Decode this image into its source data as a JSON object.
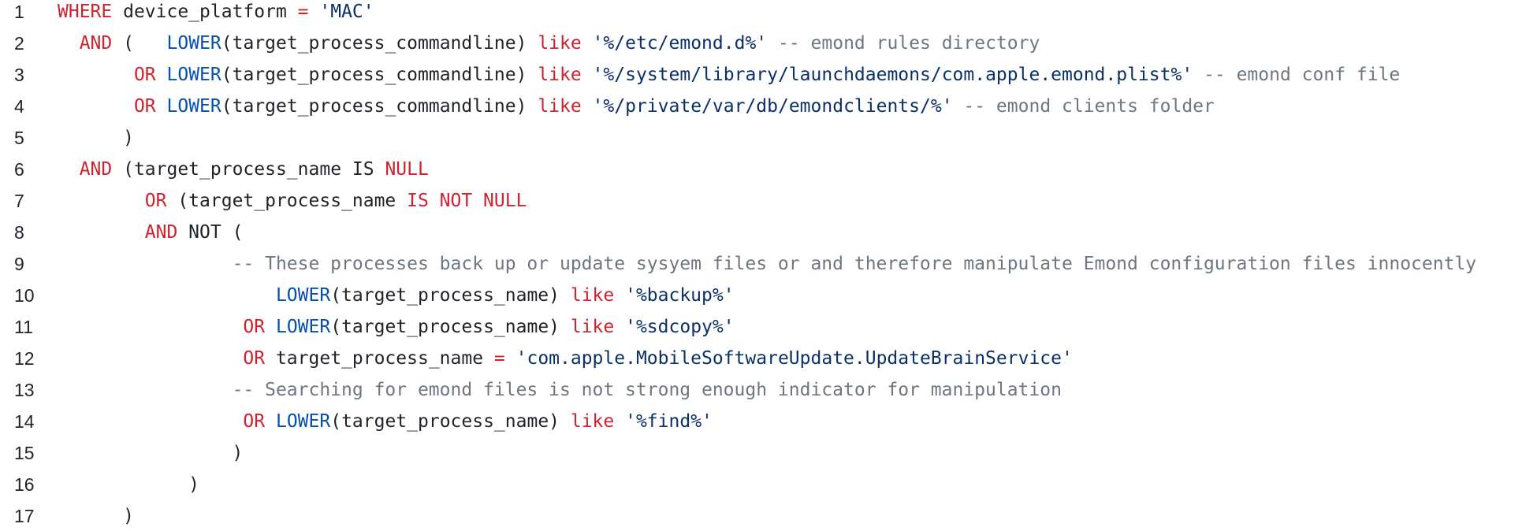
{
  "editor": {
    "lines": [
      {
        "n": "1",
        "tokens": [
          {
            "t": "WHERE",
            "c": "kw"
          },
          {
            "t": " device_platform ",
            "c": "pl"
          },
          {
            "t": "=",
            "c": "kw"
          },
          {
            "t": " ",
            "c": "pl"
          },
          {
            "t": "'MAC'",
            "c": "str"
          }
        ]
      },
      {
        "n": "2",
        "tokens": [
          {
            "t": "  ",
            "c": "pl"
          },
          {
            "t": "AND",
            "c": "kw"
          },
          {
            "t": " (   ",
            "c": "pl"
          },
          {
            "t": "LOWER",
            "c": "fn"
          },
          {
            "t": "(target_process_commandline) ",
            "c": "pl"
          },
          {
            "t": "like",
            "c": "kw"
          },
          {
            "t": " ",
            "c": "pl"
          },
          {
            "t": "'%/etc/emond.d%'",
            "c": "str"
          },
          {
            "t": " -- emond rules directory",
            "c": "cm"
          }
        ]
      },
      {
        "n": "3",
        "tokens": [
          {
            "t": "       ",
            "c": "pl"
          },
          {
            "t": "OR",
            "c": "kw"
          },
          {
            "t": " ",
            "c": "pl"
          },
          {
            "t": "LOWER",
            "c": "fn"
          },
          {
            "t": "(target_process_commandline) ",
            "c": "pl"
          },
          {
            "t": "like",
            "c": "kw"
          },
          {
            "t": " ",
            "c": "pl"
          },
          {
            "t": "'%/system/library/launchdaemons/com.apple.emond.plist%'",
            "c": "str"
          },
          {
            "t": " -- emond conf file",
            "c": "cm"
          }
        ]
      },
      {
        "n": "4",
        "tokens": [
          {
            "t": "       ",
            "c": "pl"
          },
          {
            "t": "OR",
            "c": "kw"
          },
          {
            "t": " ",
            "c": "pl"
          },
          {
            "t": "LOWER",
            "c": "fn"
          },
          {
            "t": "(target_process_commandline) ",
            "c": "pl"
          },
          {
            "t": "like",
            "c": "kw"
          },
          {
            "t": " ",
            "c": "pl"
          },
          {
            "t": "'%/private/var/db/emondclients/%'",
            "c": "str"
          },
          {
            "t": " -- emond clients folder",
            "c": "cm"
          }
        ]
      },
      {
        "n": "5",
        "tokens": [
          {
            "t": "      )",
            "c": "pl"
          }
        ]
      },
      {
        "n": "6",
        "tokens": [
          {
            "t": "  ",
            "c": "pl"
          },
          {
            "t": "AND",
            "c": "kw"
          },
          {
            "t": " (target_process_name IS ",
            "c": "pl"
          },
          {
            "t": "NULL",
            "c": "kw"
          }
        ]
      },
      {
        "n": "7",
        "tokens": [
          {
            "t": "        ",
            "c": "pl"
          },
          {
            "t": "OR",
            "c": "kw"
          },
          {
            "t": " (target_process_name ",
            "c": "pl"
          },
          {
            "t": "IS NOT NULL",
            "c": "kw"
          }
        ]
      },
      {
        "n": "8",
        "tokens": [
          {
            "t": "        ",
            "c": "pl"
          },
          {
            "t": "AND",
            "c": "kw"
          },
          {
            "t": " NOT (",
            "c": "pl"
          }
        ]
      },
      {
        "n": "9",
        "tokens": [
          {
            "t": "                ",
            "c": "pl"
          },
          {
            "t": "-- These processes back up or update sysyem files or and therefore manipulate Emond configuration files innocently",
            "c": "cm"
          }
        ]
      },
      {
        "n": "10",
        "tokens": [
          {
            "t": "                    ",
            "c": "pl"
          },
          {
            "t": "LOWER",
            "c": "fn"
          },
          {
            "t": "(target_process_name) ",
            "c": "pl"
          },
          {
            "t": "like",
            "c": "kw"
          },
          {
            "t": " ",
            "c": "pl"
          },
          {
            "t": "'%backup%'",
            "c": "str"
          }
        ]
      },
      {
        "n": "11",
        "tokens": [
          {
            "t": "                 ",
            "c": "pl"
          },
          {
            "t": "OR",
            "c": "kw"
          },
          {
            "t": " ",
            "c": "pl"
          },
          {
            "t": "LOWER",
            "c": "fn"
          },
          {
            "t": "(target_process_name) ",
            "c": "pl"
          },
          {
            "t": "like",
            "c": "kw"
          },
          {
            "t": " ",
            "c": "pl"
          },
          {
            "t": "'%sdcopy%'",
            "c": "str"
          }
        ]
      },
      {
        "n": "12",
        "tokens": [
          {
            "t": "                 ",
            "c": "pl"
          },
          {
            "t": "OR",
            "c": "kw"
          },
          {
            "t": " target_process_name ",
            "c": "pl"
          },
          {
            "t": "=",
            "c": "kw"
          },
          {
            "t": " ",
            "c": "pl"
          },
          {
            "t": "'com.apple.MobileSoftwareUpdate.UpdateBrainService'",
            "c": "str"
          }
        ]
      },
      {
        "n": "13",
        "tokens": [
          {
            "t": "                ",
            "c": "pl"
          },
          {
            "t": "-- Searching for emond files is not strong enough indicator for manipulation",
            "c": "cm"
          }
        ]
      },
      {
        "n": "14",
        "tokens": [
          {
            "t": "                 ",
            "c": "pl"
          },
          {
            "t": "OR",
            "c": "kw"
          },
          {
            "t": " ",
            "c": "pl"
          },
          {
            "t": "LOWER",
            "c": "fn"
          },
          {
            "t": "(target_process_name) ",
            "c": "pl"
          },
          {
            "t": "like",
            "c": "kw"
          },
          {
            "t": " ",
            "c": "pl"
          },
          {
            "t": "'%find%'",
            "c": "str"
          }
        ]
      },
      {
        "n": "15",
        "tokens": [
          {
            "t": "                )",
            "c": "pl"
          }
        ]
      },
      {
        "n": "16",
        "tokens": [
          {
            "t": "            )",
            "c": "pl"
          }
        ]
      },
      {
        "n": "17",
        "tokens": [
          {
            "t": "      )",
            "c": "pl"
          }
        ]
      }
    ]
  }
}
